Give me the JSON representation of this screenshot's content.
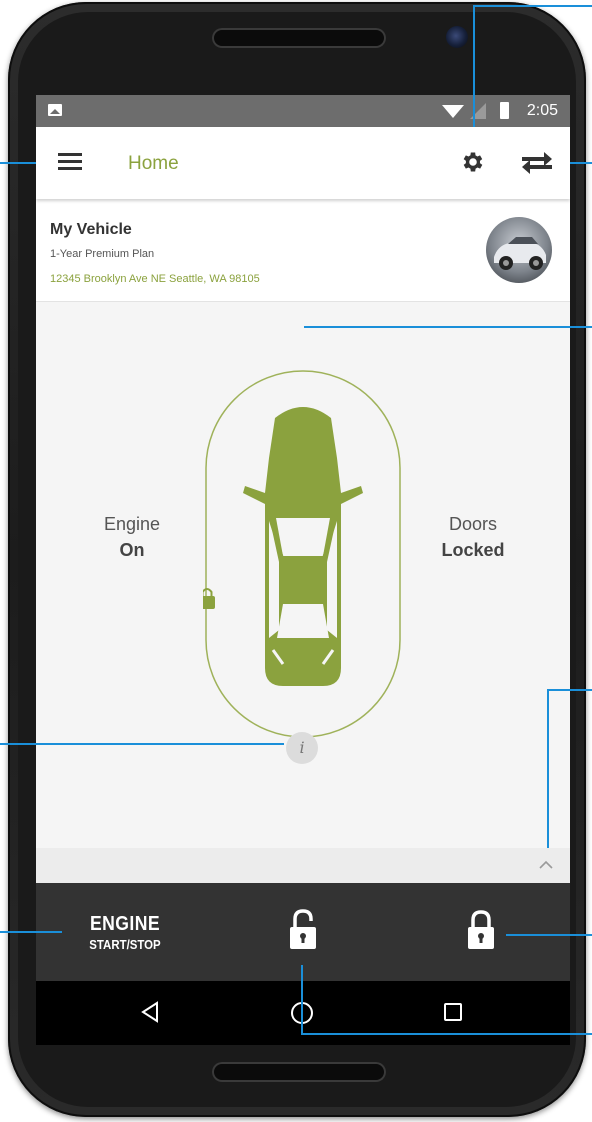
{
  "status_bar": {
    "time": "2:05"
  },
  "app_bar": {
    "title": "Home"
  },
  "vehicle": {
    "name": "My Vehicle",
    "plan": "1-Year Premium Plan",
    "address": "12345 Brooklyn Ave NE Seattle, WA 98105"
  },
  "status": {
    "engine_label": "Engine",
    "engine_value": "On",
    "doors_label": "Doors",
    "doors_value": "Locked"
  },
  "info": {
    "glyph": "i"
  },
  "actions": {
    "engine_main": "ENGINE",
    "engine_sub": "START/STOP"
  },
  "colors": {
    "accent": "#8ba23e",
    "action_bar": "#333333",
    "status_bar": "#6d6d6d",
    "callout": "#1a8fd9"
  },
  "icons": {
    "menu": "menu-icon",
    "settings": "gear-icon",
    "switch_vehicle": "swap-icon",
    "info": "info-icon",
    "expand": "chevron-up-icon",
    "unlock": "unlock-icon",
    "lock": "lock-icon",
    "back": "nav-back-icon",
    "home": "nav-home-icon",
    "recents": "nav-recents-icon"
  }
}
